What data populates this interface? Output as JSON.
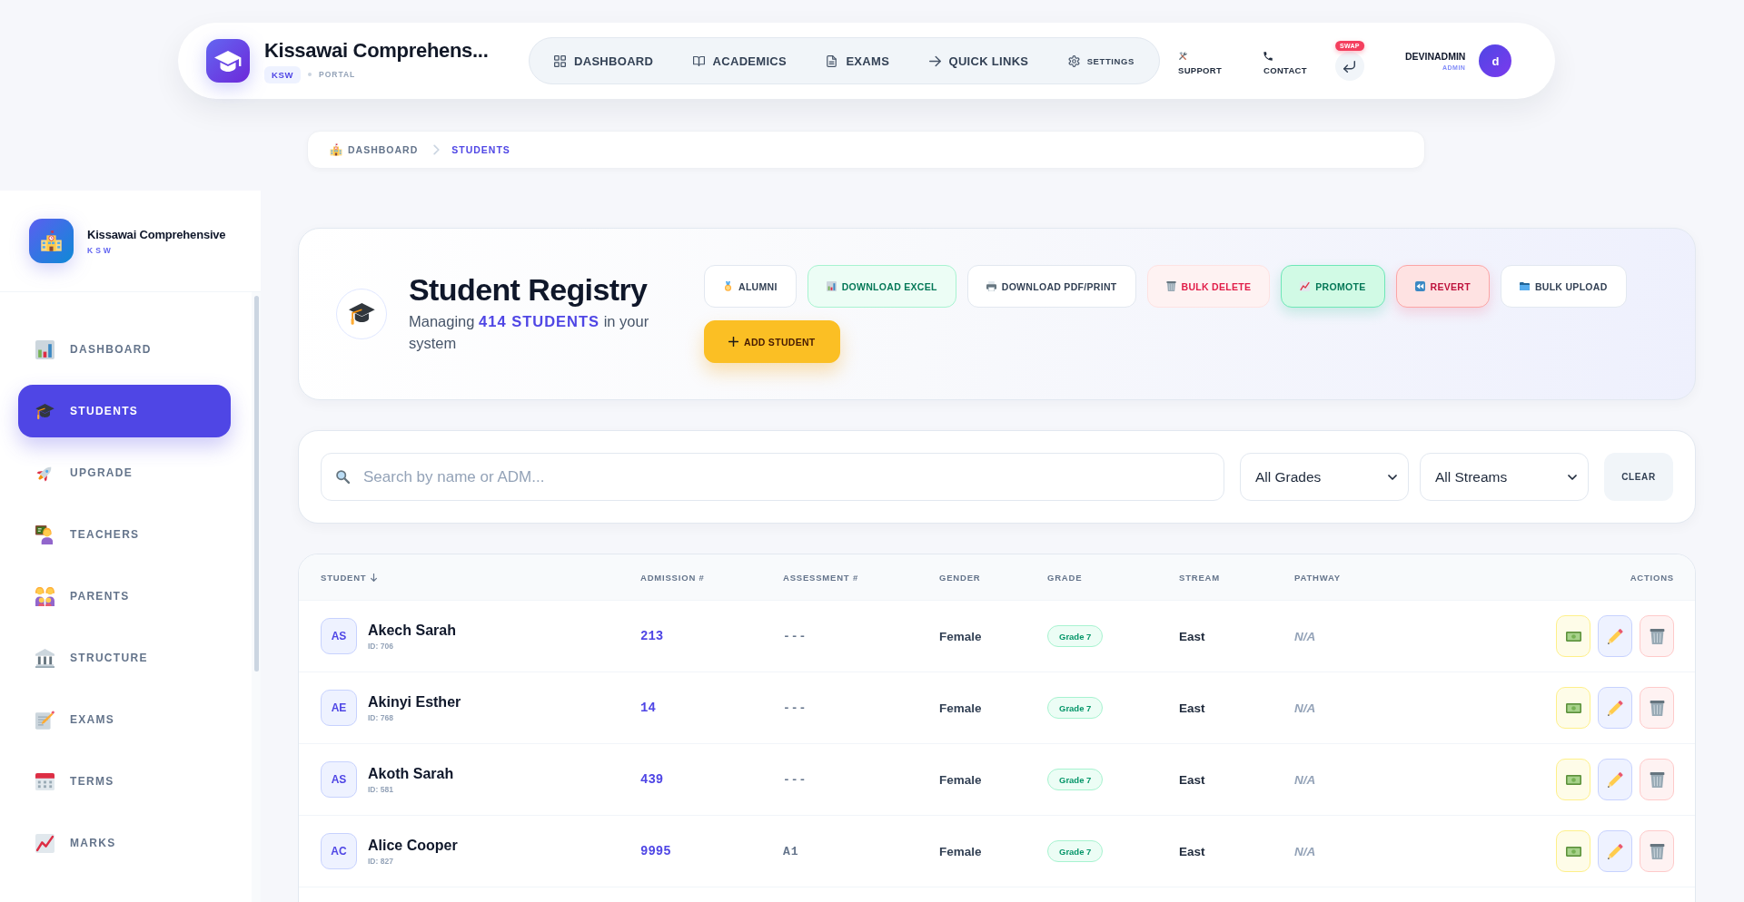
{
  "header": {
    "school_name": "Kissawai Comprehens...",
    "school_code": "KSW",
    "portal_label": "PORTAL",
    "nav": [
      {
        "label": "DASHBOARD"
      },
      {
        "label": "ACADEMICS"
      },
      {
        "label": "EXAMS"
      },
      {
        "label": "QUICK LINKS"
      },
      {
        "label": "SETTINGS"
      }
    ],
    "links": [
      {
        "label": "SUPPORT"
      },
      {
        "label": "CONTACT"
      }
    ],
    "swap_badge": "SWAP",
    "user": {
      "name": "DEVINADMIN",
      "role": "ADMIN",
      "initial": "d"
    }
  },
  "breadcrumb": [
    {
      "label": "DASHBOARD",
      "current": false
    },
    {
      "label": "STUDENTS",
      "current": true
    }
  ],
  "sidebar": {
    "school_name": "Kissawai Comprehensive",
    "school_code": "KSW",
    "items": [
      {
        "label": "DASHBOARD",
        "selected": false
      },
      {
        "label": "STUDENTS",
        "selected": true
      },
      {
        "label": "UPGRADE",
        "selected": false
      },
      {
        "label": "TEACHERS",
        "selected": false
      },
      {
        "label": "PARENTS",
        "selected": false
      },
      {
        "label": "STRUCTURE",
        "selected": false
      },
      {
        "label": "EXAMS",
        "selected": false
      },
      {
        "label": "TERMS",
        "selected": false
      },
      {
        "label": "MARKS",
        "selected": false
      }
    ]
  },
  "registry": {
    "title": "Student Registry",
    "subtitle": "Managing **414 STUDENTS** in your system",
    "actions": [
      {
        "label": "ALUMNI",
        "kind": "default"
      },
      {
        "label": "DOWNLOAD EXCEL",
        "kind": "export"
      },
      {
        "label": "DOWNLOAD PDF/PRINT",
        "kind": "default"
      },
      {
        "label": "BULK DELETE",
        "kind": "destructive"
      },
      {
        "label": "PROMOTE",
        "kind": "confirm"
      },
      {
        "label": "REVERT",
        "kind": "undo"
      },
      {
        "label": "BULK UPLOAD",
        "kind": "default"
      },
      {
        "label": "ADD STUDENT",
        "kind": "primary"
      }
    ]
  },
  "filters": {
    "search": {
      "placeholder": "Search by name or ADM..."
    },
    "grade_select": {
      "value": "All Grades"
    },
    "stream_select": {
      "value": "All Streams"
    },
    "clear_button": {
      "label": "CLEAR"
    }
  },
  "table": {
    "columns": [
      {
        "label": "STUDENT",
        "sorted": true
      },
      {
        "label": "ADMISSION #",
        "sorted": false
      },
      {
        "label": "ASSESSMENT #",
        "sorted": false
      },
      {
        "label": "GENDER",
        "sorted": false
      },
      {
        "label": "GRADE",
        "sorted": false
      },
      {
        "label": "STREAM",
        "sorted": false
      },
      {
        "label": "PATHWAY",
        "sorted": false
      },
      {
        "label": "ACTIONS",
        "sorted": false
      }
    ],
    "rows": [
      {
        "initials": "AS",
        "name": "Akech Sarah",
        "id": "ID: 706",
        "admission": "213",
        "assessment": "---",
        "gender": "Female",
        "grade": "Grade 7",
        "stream": "East",
        "pathway": "N/A"
      },
      {
        "initials": "AE",
        "name": "Akinyi Esther",
        "id": "ID: 768",
        "admission": "14",
        "assessment": "---",
        "gender": "Female",
        "grade": "Grade 7",
        "stream": "East",
        "pathway": "N/A"
      },
      {
        "initials": "AS",
        "name": "Akoth Sarah",
        "id": "ID: 581",
        "admission": "439",
        "assessment": "---",
        "gender": "Female",
        "grade": "Grade 7",
        "stream": "East",
        "pathway": "N/A"
      },
      {
        "initials": "AC",
        "name": "Alice Cooper",
        "id": "ID: 827",
        "admission": "9995",
        "assessment": "A1",
        "gender": "Female",
        "grade": "Grade 7",
        "stream": "East",
        "pathway": "N/A"
      }
    ]
  }
}
